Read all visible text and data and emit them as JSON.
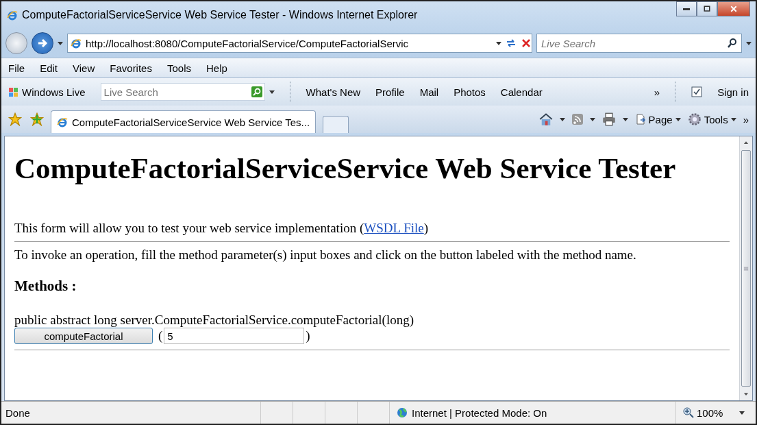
{
  "window": {
    "title": "ComputeFactorialServiceService Web Service Tester - Windows Internet Explorer"
  },
  "address": {
    "url": "http://localhost:8080/ComputeFactorialService/ComputeFactorialServic"
  },
  "search": {
    "placeholder": "Live Search"
  },
  "menu": [
    "File",
    "Edit",
    "View",
    "Favorites",
    "Tools",
    "Help"
  ],
  "links_bar": {
    "brand": "Windows Live",
    "search_placeholder": "Live Search",
    "links": [
      "What's New",
      "Profile",
      "Mail",
      "Photos",
      "Calendar"
    ],
    "chevron": "»",
    "sign_in": "Sign in"
  },
  "tabs": [
    {
      "title": "ComputeFactorialServiceService Web Service Tes...",
      "selected": true
    }
  ],
  "command_bar": {
    "page": "Page",
    "tools": "Tools",
    "chevron": "»"
  },
  "content": {
    "heading": "ComputeFactorialServiceService Web Service Tester",
    "intro": {
      "text_before": "This form will allow you to test your web service implementation (",
      "link": "WSDL File",
      "text_after": ")"
    },
    "instructions": "To invoke an operation, fill the method parameter(s) input boxes and click on the button labeled with the method name.",
    "methods_heading": "Methods :",
    "methods": [
      {
        "signature": "public abstract long server.ComputeFactorialService.computeFactorial(long)",
        "button": "computeFactorial",
        "open_paren": "(",
        "value": "5",
        "close_paren": ")"
      }
    ]
  },
  "status_bar": {
    "status": "Done",
    "zone": "Internet | Protected Mode: On",
    "zoom": "100%"
  }
}
